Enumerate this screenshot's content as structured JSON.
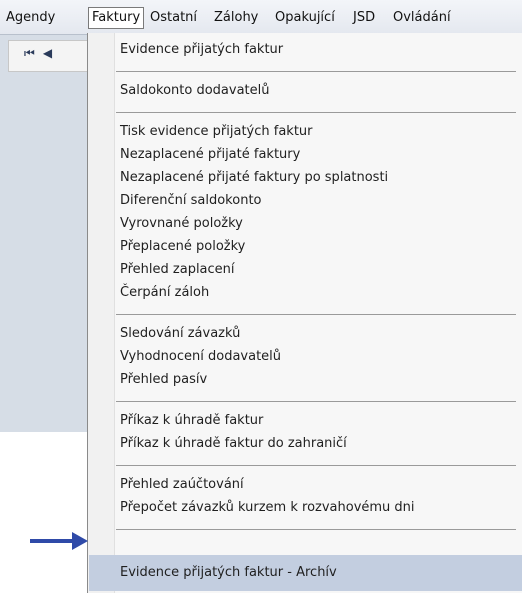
{
  "menubar": {
    "items": [
      "Agendy",
      "Faktury",
      "Ostatní",
      "Zálohy",
      "Opakující",
      "JSD",
      "Ovládání"
    ],
    "active_index": 1
  },
  "toolbar": {
    "nav_first_icon": "first-record-icon",
    "nav_prev_icon": "previous-record-icon"
  },
  "dropdown": {
    "groups": [
      [
        "Evidence přijatých faktur"
      ],
      [
        "Saldokonto dodavatelů"
      ],
      [
        "Tisk evidence přijatých faktur",
        "Nezaplacené přijaté faktury",
        "Nezaplacené přijaté faktury po splatnosti",
        "Diferenční saldokonto",
        "Vyrovnané položky",
        "Přeplacené položky",
        "Přehled zaplacení",
        "Čerpání záloh"
      ],
      [
        "Sledování závazků",
        "Vyhodnocení dodavatelů",
        "Přehled pasív"
      ],
      [
        "Příkaz k úhradě faktur",
        "Příkaz k úhradě faktur do zahraničí"
      ],
      [
        "Přehled zaúčtování",
        "Přepočet závazků kurzem k rozvahovému dni"
      ],
      [
        "Evidence přijatých faktur - Archív"
      ]
    ],
    "highlighted_item": "Evidence přijatých faktur - Archív",
    "highlight_color": "#c3cee0",
    "arrow_icon": "pointer-arrow-icon",
    "arrow_color": "#2f4aa8"
  }
}
